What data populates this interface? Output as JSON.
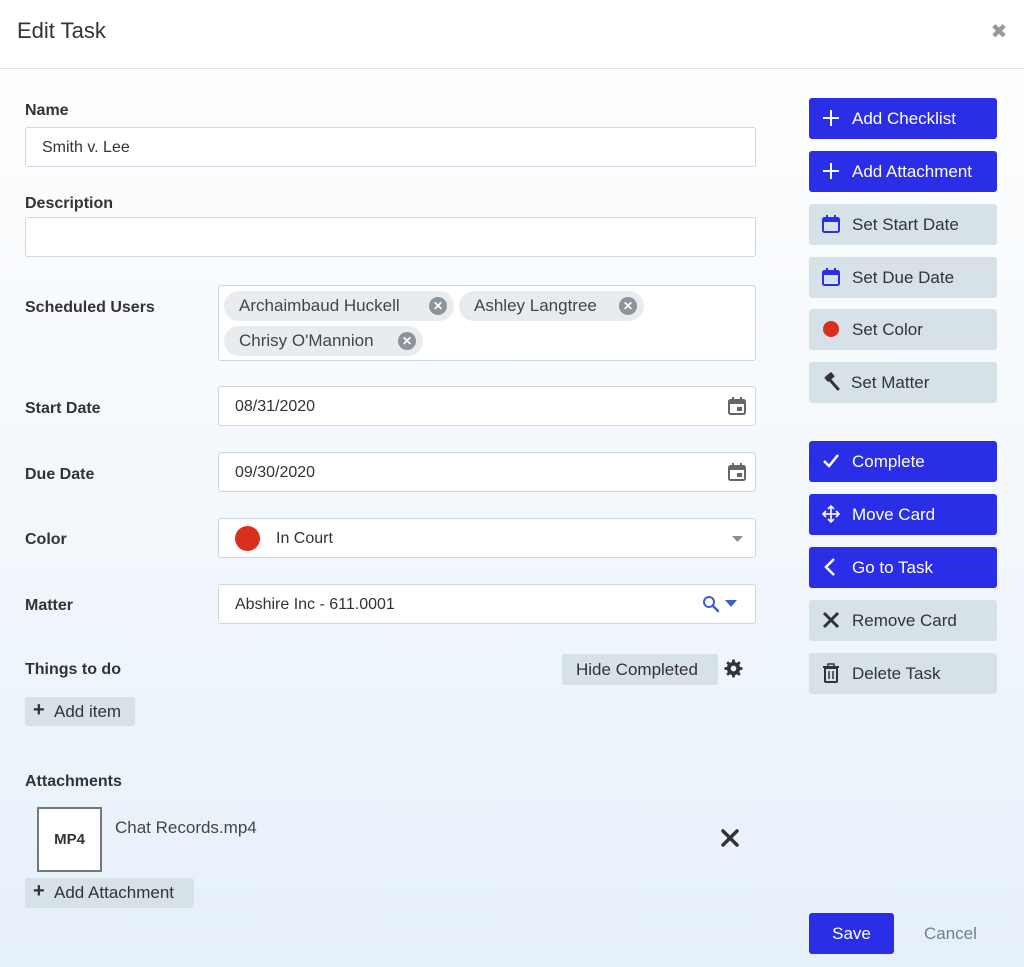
{
  "dialog": {
    "title": "Edit Task",
    "close_icon": "close-icon"
  },
  "form": {
    "name_label": "Name",
    "name_value": "Smith v. Lee",
    "description_label": "Description",
    "description_value": "",
    "scheduled_users_label": "Scheduled Users",
    "scheduled_users": [
      "Archaimbaud Huckell",
      "Ashley Langtree",
      "Chrisy O'Mannion"
    ],
    "start_date_label": "Start Date",
    "start_date_value": "08/31/2020",
    "due_date_label": "Due Date",
    "due_date_value": "09/30/2020",
    "color_label": "Color",
    "color_value": "In Court",
    "color_swatch": "#d9301e",
    "matter_label": "Matter",
    "matter_value": "Abshire Inc - 611.0001",
    "things_label": "Things to do",
    "hide_completed_label": "Hide Completed",
    "add_item_label": "Add item",
    "attachments_label": "Attachments",
    "attachment": {
      "type_label": "MP4",
      "filename": "Chat Records.mp4"
    },
    "add_attachment_label": "Add Attachment"
  },
  "actions": [
    {
      "label": "Add Checklist",
      "icon": "plus-icon",
      "style": "blue"
    },
    {
      "label": "Add Attachment",
      "icon": "plus-icon",
      "style": "blue"
    },
    {
      "label": "Set Start Date",
      "icon": "calendar-icon",
      "style": "gray"
    },
    {
      "label": "Set Due Date",
      "icon": "calendar-icon",
      "style": "gray"
    },
    {
      "label": "Set Color",
      "icon": "color-dot-icon",
      "style": "gray"
    },
    {
      "label": "Set Matter",
      "icon": "gavel-icon",
      "style": "gray"
    },
    {
      "label": "Complete",
      "icon": "check-icon",
      "style": "blue"
    },
    {
      "label": "Move Card",
      "icon": "move-icon",
      "style": "blue"
    },
    {
      "label": "Go to Task",
      "icon": "chevron-left-icon",
      "style": "blue"
    },
    {
      "label": "Remove Card",
      "icon": "x-icon",
      "style": "gray"
    },
    {
      "label": "Delete Task",
      "icon": "trash-icon",
      "style": "gray"
    }
  ],
  "footer": {
    "save_label": "Save",
    "cancel_label": "Cancel"
  },
  "colors": {
    "primary": "#2a2ee6",
    "secondary_button": "#d6e1e8",
    "link": "#6a7f9b"
  }
}
